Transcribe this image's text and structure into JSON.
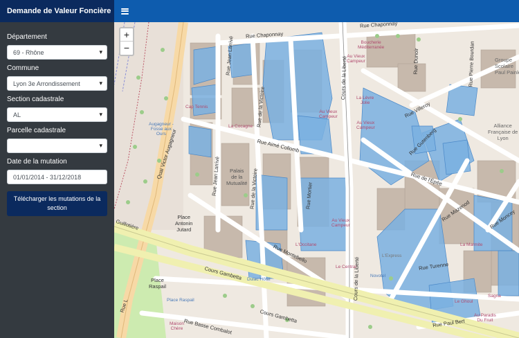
{
  "header": {
    "title": "Demande de Valeur Foncière"
  },
  "sidebar": {
    "departement": {
      "label": "Département",
      "value": "69 - Rhône"
    },
    "commune": {
      "label": "Commune",
      "value": "Lyon 3e Arrondissement"
    },
    "section": {
      "label": "Section cadastrale",
      "value": "AL"
    },
    "parcelle": {
      "label": "Parcelle cadastrale",
      "value": ""
    },
    "date": {
      "label": "Date de la mutation",
      "value": "01/01/2014 - 31/12/2018"
    },
    "download_label": "Télécharger les mutations de la section"
  },
  "map": {
    "zoom_in": "+",
    "zoom_out": "−",
    "streets": {
      "chaponnay_1": "Rue Chaponnay",
      "chaponnay_2": "Rue Chaponnay",
      "larrive_1": "Rue Jean Larrivé",
      "larrive_2": "Rue Jean Larrivé",
      "victoire_1": "Rue de la Victoire",
      "victoire_2": "Rue de la Victoire",
      "liberte_1": "Cours de la Liberté",
      "liberte_2": "Cours de la Liberté",
      "dunoir": "Rue Dunoir",
      "bourdan": "Rue Pierre Bourdan",
      "villeroy": "Rue Villeroy",
      "gutenberg": "Rue Gutenberg",
      "aime_collomb": "Rue Aimé Collomb",
      "epee": "Rue de l'Épée",
      "mazenod": "Rue Mazenod",
      "moncey": "Rue Moncey",
      "turenne": "Rue Turenne",
      "augagneur": "Quai Victor Augagneur",
      "montebello": "Rue Montebello",
      "mortier": "Rue Mortier",
      "gambetta_1": "Cours Gambetta",
      "gambetta_2": "Cours Gambetta",
      "paul_bert": "Rue Paul Bert",
      "basse_combalot": "Rue Basse Combalot",
      "guillotiere": "Guillotière",
      "rue_l": "Rue L"
    },
    "places": {
      "antonin_jutard": "Place\nAntonin\nJutard",
      "raspail": "Place\nRaspail",
      "place_raspail_poi": "Place Raspail",
      "groupe_scolaire": "Groupe\nScolaire\nPaul Painlevé",
      "alliance": "Alliance\nFrançaise de\nLyon",
      "palais_mutualite": "Palais\nde la\nMutualité"
    },
    "pois": {
      "boucherie": "Boucherie\nMéditerranée",
      "vieux_campeur_1": "Au Vieux\nCampeur",
      "vieux_campeur_2": "Au Vieux\nCampeur",
      "vieux_campeur_3": "Au Vieux\nCampeur",
      "vieux_campeur_4": "Au Vieux\nCampeur",
      "cap_tennis": "Cap Tennis",
      "cocagne": "La Cocagne",
      "aurgagneur_fosse": "Augagneur -\nFosse aux\nOurs",
      "levre_jolie": "La Lèvre\nJolie",
      "l_occitane": "L'Occitane",
      "le_central": "Le Central",
      "dulac_hotel": "Dulac Hôtel",
      "l_express": "L'Express",
      "novotel": "Novotel",
      "le_ghoul": "Le Ghoul",
      "la_marmite": "La Marmite",
      "maison_chere": "Maison\nChère",
      "paradis": "Au Paradis\nDu Fruit",
      "sagna": "Sagna"
    },
    "colors": {
      "parcel": "#7ab0e0",
      "building": "#c7b9ac",
      "road": "#ffffff",
      "major_road": "#f7d9a6",
      "tram": "#f0f0b0",
      "park": "#cdebb0"
    }
  }
}
